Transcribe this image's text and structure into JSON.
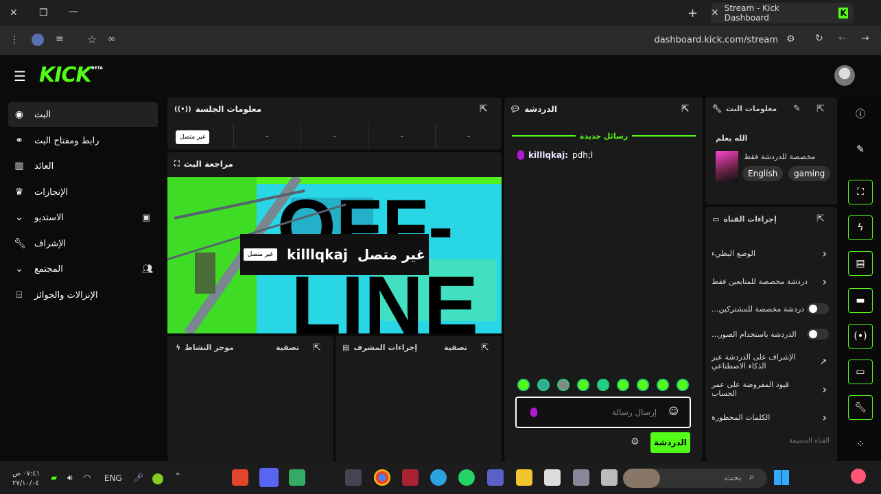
{
  "browser": {
    "tab_title": "Stream - Kick Dashboard",
    "tab_logo": "K",
    "url": "dashboard.kick.com/stream"
  },
  "app": {
    "brand": "KICK",
    "beta": "BETA"
  },
  "sidebar": {
    "items": [
      {
        "label": "البث",
        "icon": "broadcast-icon",
        "glyph": "(•)"
      },
      {
        "label": "رابط ومفتاح البث",
        "icon": "link-icon",
        "glyph": "∞"
      },
      {
        "label": "العائد",
        "icon": "chart-icon",
        "glyph": "▥"
      },
      {
        "label": "الإنجازات",
        "icon": "trophy-icon",
        "glyph": "♛"
      },
      {
        "label": "الاستديو",
        "icon": "chevron-down-icon",
        "glyph": "⌄"
      },
      {
        "label": "الإشراف",
        "icon": "wrench-icon",
        "glyph": "✎"
      },
      {
        "label": "المجتمع",
        "icon": "chevron-down-icon",
        "glyph": "⌄"
      },
      {
        "label": "الإنزالات والجوائز",
        "icon": "gift-icon",
        "glyph": "⌸"
      }
    ]
  },
  "session": {
    "title": "معلومات الجلسة",
    "status_badge": "غير متصل",
    "stats": [
      "-",
      "-",
      "-",
      "-"
    ]
  },
  "review": {
    "title": "مراجعة البث",
    "offline_name": "killlqkaj",
    "offline_label": "غير متصل",
    "offline_tag": "غير متصل"
  },
  "activity": {
    "title": "موجز النشاط",
    "filter": "تصفية"
  },
  "mod_actions": {
    "title": "إجراءات المشرف",
    "filter": "تصفية"
  },
  "chat": {
    "title": "الدردشة",
    "new_messages": "رسائل جديدة",
    "messages": [
      {
        "user": "killlqkaj:",
        "text": "pdh;l"
      }
    ],
    "input_placeholder": "إرسال رسالة",
    "send_button": "الدردشة"
  },
  "stream_info": {
    "title": "معلومات البث",
    "stream_title": "الله يعلم",
    "category_note": "مخصصة للدردشة فقط",
    "tags": [
      "English",
      "gaming"
    ]
  },
  "channel_actions": {
    "title": "إجراءات القناة",
    "items": [
      {
        "label": "الوضع البطيء",
        "control": "chevron"
      },
      {
        "label": "دردشة مخصصة للمتابعين فقط",
        "control": "chevron"
      },
      {
        "label": "...دردشة مخصصة للمشتركين",
        "control": "toggle",
        "on": false
      },
      {
        "label": "...الدردشة باستخدام الصور",
        "control": "toggle",
        "on": false
      },
      {
        "label": "الإشراف على الدردشة عبر الذكاء الاصطناعي",
        "control": "external"
      },
      {
        "label": "قيود المفروضة على عمر الحساب",
        "control": "chevron"
      },
      {
        "label": "الكلمات المحظورة",
        "control": "chevron"
      }
    ],
    "footer": "القناة المضيفة"
  },
  "taskbar": {
    "time": "٠٧:٤١ ص",
    "date": "٢٧/١٠/٠٤",
    "lang": "ENG",
    "search_placeholder": "بحث"
  },
  "colors": {
    "accent": "#53fc18",
    "panel": "#1a1a1a",
    "bg": "#0b0b0b"
  }
}
